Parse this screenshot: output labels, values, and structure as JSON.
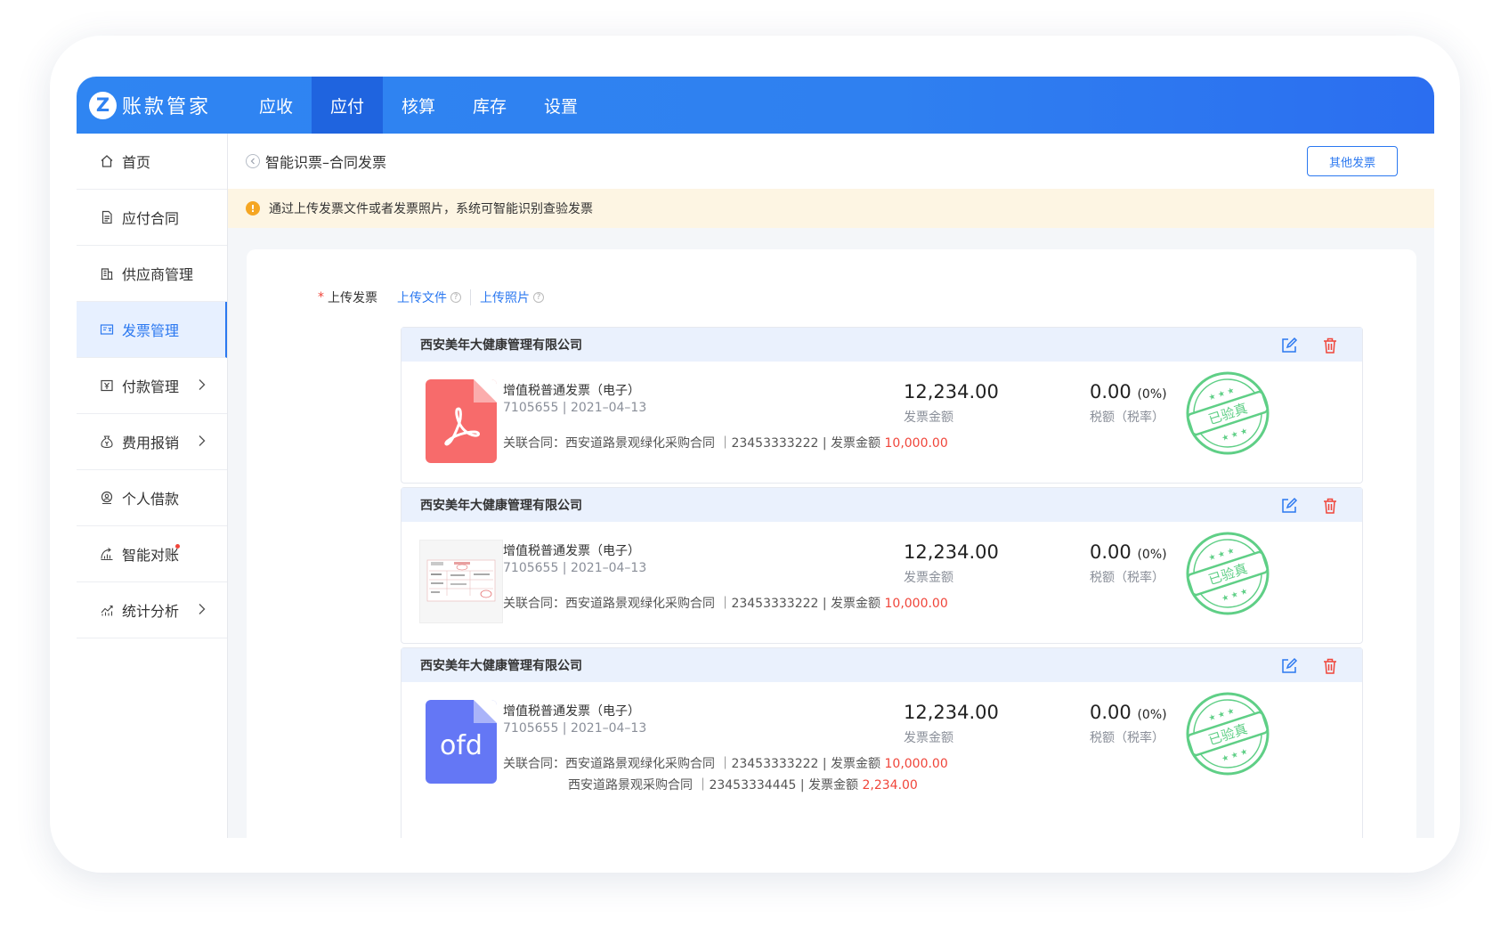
{
  "app": {
    "logo_letter": "Z",
    "name": "账款管家"
  },
  "topnav": [
    {
      "label": "应收",
      "active": false
    },
    {
      "label": "应付",
      "active": true
    },
    {
      "label": "核算",
      "active": false
    },
    {
      "label": "库存",
      "active": false
    },
    {
      "label": "设置",
      "active": false
    }
  ],
  "sidebar": {
    "items": [
      {
        "label": "首页",
        "icon": "home-icon"
      },
      {
        "label": "应付合同",
        "icon": "document-icon"
      },
      {
        "label": "供应商管理",
        "icon": "building-icon"
      },
      {
        "label": "发票管理",
        "icon": "invoice-icon",
        "active": true
      },
      {
        "label": "付款管理",
        "icon": "payment-icon",
        "chevron": true
      },
      {
        "label": "费用报销",
        "icon": "money-bag-icon",
        "chevron": true
      },
      {
        "label": "个人借款",
        "icon": "loan-icon"
      },
      {
        "label": "智能对账",
        "icon": "reconcile-icon",
        "dot": true
      },
      {
        "label": "统计分析",
        "icon": "chart-icon",
        "chevron": true
      }
    ]
  },
  "header": {
    "title": "智能识票–合同发票",
    "other_button": "其他发票"
  },
  "notice": {
    "text": "通过上传发票文件或者发票照片，系统可智能识别查验发票"
  },
  "upload": {
    "required_mark": "*",
    "label": "上传发票",
    "link_file": "上传文件",
    "link_photo": "上传照片",
    "help_glyph": "?"
  },
  "invoices": [
    {
      "company": "西安美年大健康管理有限公司",
      "file_type": "pdf",
      "type_label": "增值税普通发票（电子）",
      "meta": "7105655 | 2021–04–13",
      "links": [
        {
          "prefix": "关联合同：",
          "text": "西安道路景观绿化采购合同 ｜23453333222 | 发票金额 ",
          "amount": "10,000.00"
        }
      ],
      "amount": "12,234.00",
      "amount_label": "发票金额",
      "tax": "0.00",
      "tax_rate": "(0%)",
      "tax_label": "税额（税率）",
      "stamp": "已验真"
    },
    {
      "company": "西安美年大健康管理有限公司",
      "file_type": "image",
      "type_label": "增值税普通发票（电子）",
      "meta": "7105655 | 2021–04–13",
      "links": [
        {
          "prefix": "关联合同：",
          "text": "西安道路景观绿化采购合同 ｜23453333222 | 发票金额 ",
          "amount": "10,000.00"
        }
      ],
      "amount": "12,234.00",
      "amount_label": "发票金额",
      "tax": "0.00",
      "tax_rate": "(0%)",
      "tax_label": "税额（税率）",
      "stamp": "已验真"
    },
    {
      "company": "西安美年大健康管理有限公司",
      "file_type": "ofd",
      "file_label": "ofd",
      "type_label": "增值税普通发票（电子）",
      "meta": "7105655 | 2021–04–13",
      "links": [
        {
          "prefix": "关联合同：",
          "text": "西安道路景观绿化采购合同 ｜23453333222 | 发票金额 ",
          "amount": "10,000.00"
        },
        {
          "prefix": "",
          "text": "西安道路景观采购合同 ｜23453334445 | 发票金额 ",
          "amount": "2,234.00"
        }
      ],
      "amount": "12,234.00",
      "amount_label": "发票金额",
      "tax": "0.00",
      "tax_rate": "(0%)",
      "tax_label": "税额（税率）",
      "stamp": "已验真"
    }
  ],
  "colors": {
    "primary": "#2b78f0",
    "danger": "#f0453a",
    "pdf": "#f76b6b",
    "ofd": "#6477f5",
    "stamp": "#5fcf86",
    "notice_bg": "#fdf5e3"
  }
}
